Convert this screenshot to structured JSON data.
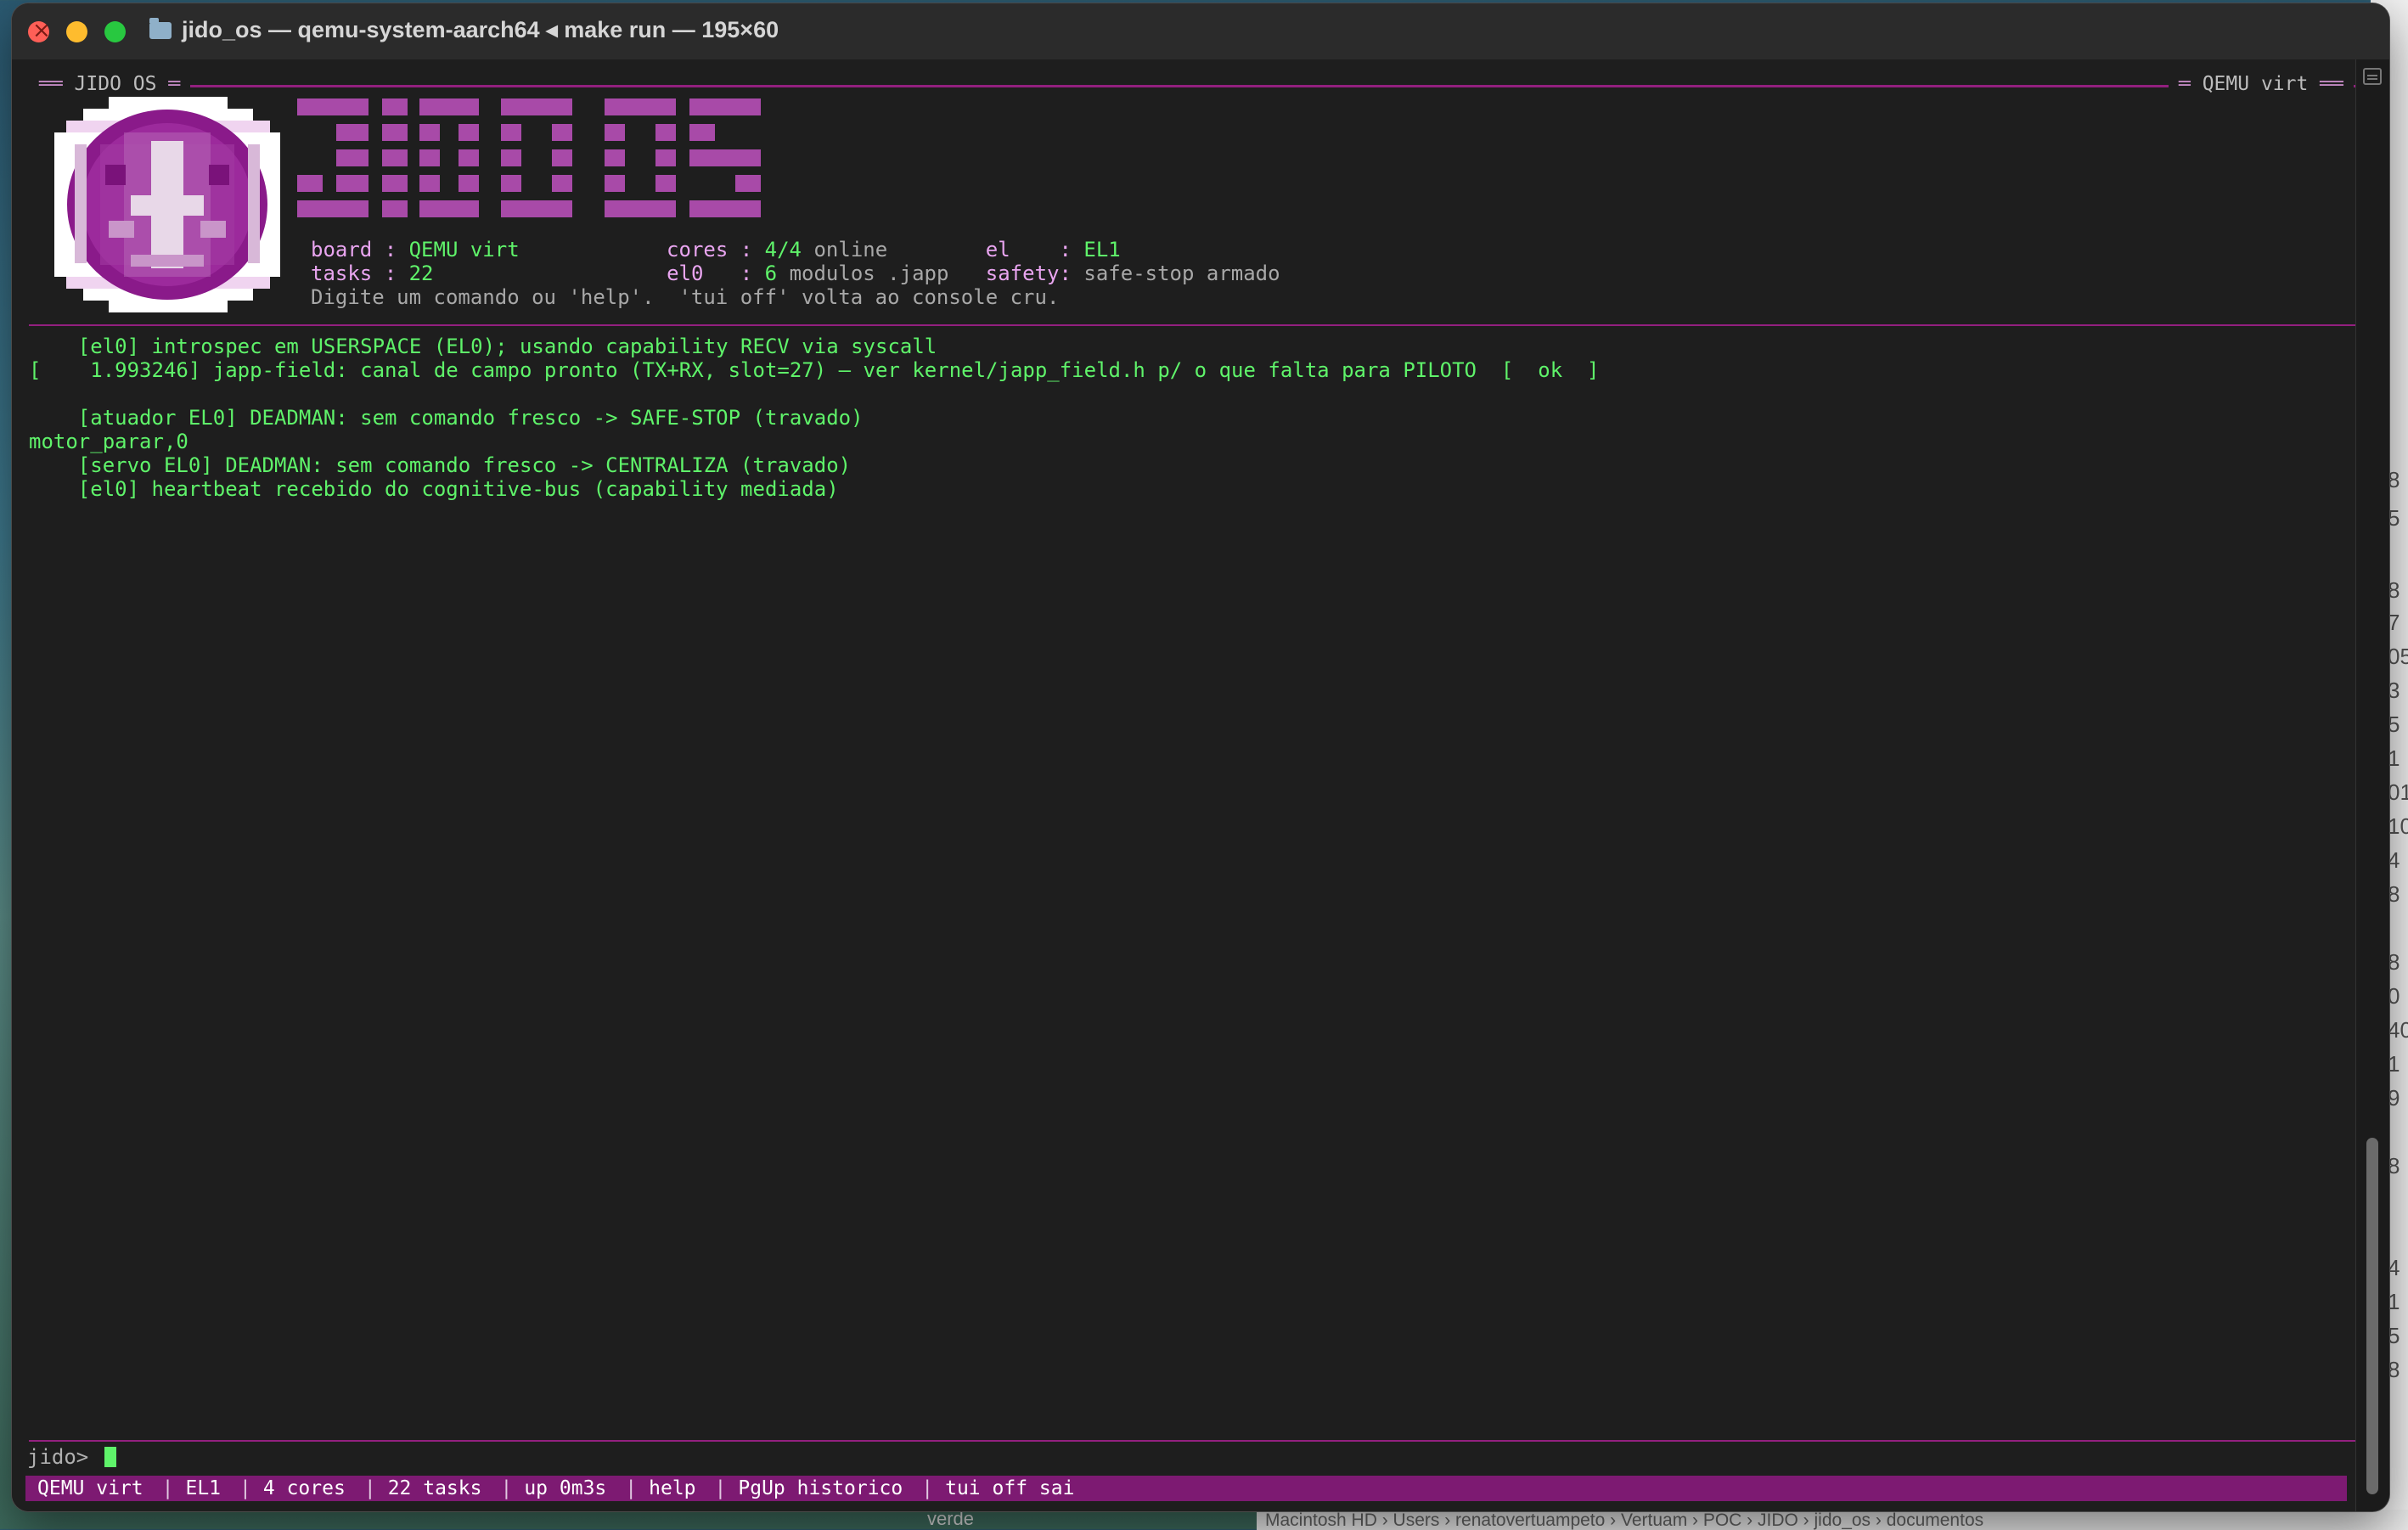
{
  "window": {
    "title": "jido_os — qemu-system-aarch64 ◂ make run — 195×60"
  },
  "header": {
    "left_label": "JIDO OS",
    "right_label": "QEMU virt"
  },
  "banner": {
    "logo_text": "JIDOS",
    "info": {
      "board_label": "board :",
      "board_value": "QEMU virt",
      "tasks_label": "tasks :",
      "tasks_value": "22",
      "cores_label": "cores :",
      "cores_value": "4/4",
      "cores_suffix": "online",
      "el0_label": "el0   :",
      "el0_value": "6",
      "el0_suffix": "modulos .japp",
      "el_label": "el    :",
      "el_value": "EL1",
      "safety_label": "safety:",
      "safety_value": "safe-stop armado",
      "hint": "Digite um comando ou 'help'.  'tui off' volta ao console cru."
    }
  },
  "log": [
    "    [el0] introspec em USERSPACE (EL0); usando capability RECV via syscall",
    "[    1.993246] japp-field: canal de campo pronto (TX+RX, slot=27) — ver kernel/japp_field.h p/ o que falta para PILOTO  [  ok  ]",
    "",
    "    [atuador EL0] DEADMAN: sem comando fresco -> SAFE-STOP (travado)",
    "motor_parar,0",
    "    [servo EL0] DEADMAN: sem comando fresco -> CENTRALIZA (travado)",
    "    [el0] heartbeat recebido do cognitive-bus (capability mediada)"
  ],
  "prompt": "jido>",
  "statusbar": {
    "board": "QEMU virt",
    "el": "EL1",
    "cores": "4 cores",
    "tasks": "22 tasks",
    "uptime": "up 0m3s",
    "help": "help",
    "history": "PgUp historico",
    "exit": "tui off sai",
    "separator": "|"
  },
  "background": {
    "behind_label": "verde",
    "finder_path": "Macintosh HD › Users › renatovertuampeto › Vertuam › POC › JIDO › jido_os › documentos",
    "right_edge_digits": [
      "8",
      "5",
      "8",
      "7",
      "05",
      "3",
      "5",
      "1",
      "01",
      "10",
      "4",
      "8",
      "8",
      "0",
      "40",
      "1",
      "9",
      "8",
      "4",
      "1",
      "5",
      "8"
    ]
  },
  "colors": {
    "terminal_bg": "#1e1e1e",
    "text_green": "#5ff36a",
    "accent_purple": "#93207f",
    "statusbar_bg": "#7d1a72",
    "label_pink": "#e9a5f0"
  }
}
